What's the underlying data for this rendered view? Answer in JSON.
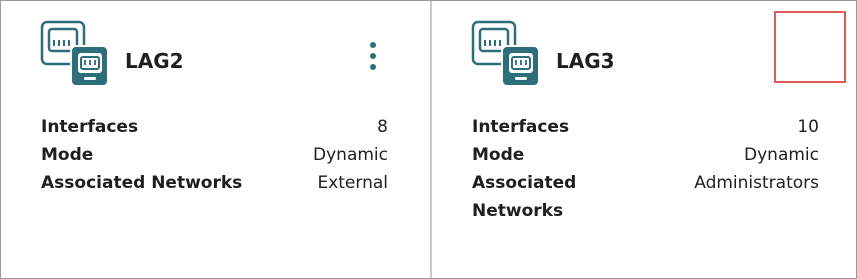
{
  "cards": [
    {
      "title": "LAG2",
      "icon": "lag-ports-icon",
      "menu_icon": "kebab-menu-icon",
      "properties": [
        {
          "label": "Interfaces",
          "value": "8"
        },
        {
          "label": "Mode",
          "value": "Dynamic"
        },
        {
          "label": "Associated Networks",
          "value": "External"
        }
      ]
    },
    {
      "title": "LAG3",
      "icon": "lag-ports-icon",
      "properties": [
        {
          "label": "Interfaces",
          "value": "10"
        },
        {
          "label": "Mode",
          "value": "Dynamic"
        },
        {
          "label": "Associated Networks",
          "value": "Administrators"
        }
      ]
    }
  ],
  "colors": {
    "icon_primary": "#2c6e7a",
    "highlight": "#e05a5a",
    "divider": "#c9c9c9"
  }
}
